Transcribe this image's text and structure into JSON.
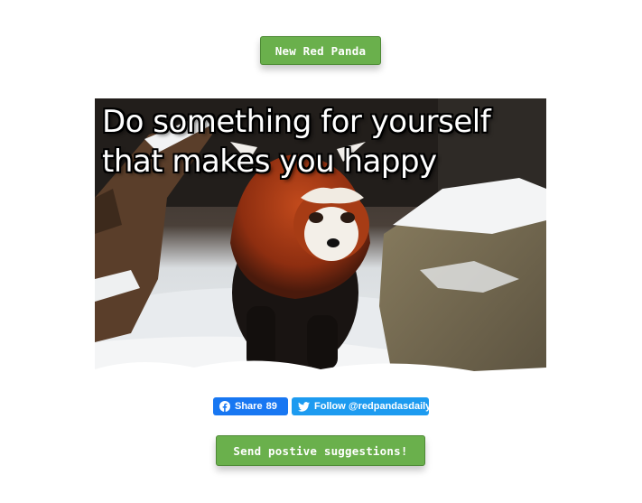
{
  "buttons": {
    "new_panda": "New Red Panda",
    "send_suggestions": "Send postive suggestions!"
  },
  "image": {
    "quote_line1": "Do something for yourself",
    "quote_line2": "that makes you happy",
    "subject": "red panda walking in snow"
  },
  "social": {
    "share_label": "Share",
    "share_count": "89",
    "follow_label": "Follow @redpandasdaily",
    "share_icon": "facebook-icon",
    "follow_icon": "twitter-bird-icon"
  },
  "colors": {
    "button_green": "#6ab04c",
    "facebook_blue": "#1877f2",
    "twitter_blue": "#1d9bf0"
  }
}
